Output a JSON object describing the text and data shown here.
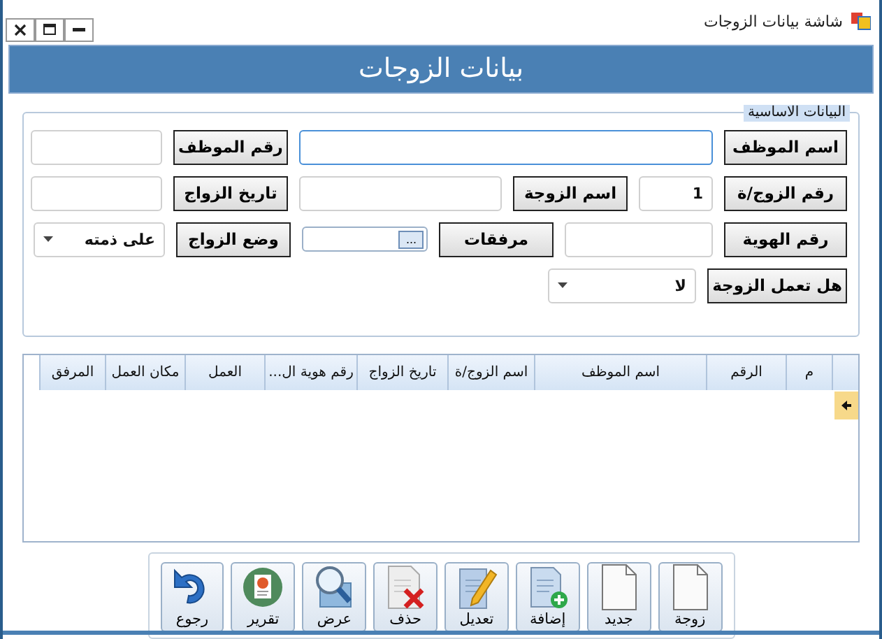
{
  "window": {
    "title": "شاشة بيانات الزوجات"
  },
  "header": {
    "title": "بيانات الزوجات"
  },
  "basic_data": {
    "legend": "البيانات الاساسية",
    "fields": [
      {
        "label": "اسم الموظف",
        "input": {
          "kind": "text",
          "focused": true
        }
      },
      {
        "label": "رقم الموظف",
        "input": {
          "kind": "text",
          "focused": false
        }
      },
      {
        "label": "رقم الزوج/ة",
        "input": {
          "kind": "text",
          "value": "1",
          "focused": false
        }
      },
      {
        "label": "اسم الزوجة",
        "input": {
          "kind": "text",
          "focused": false
        }
      },
      {
        "label": "تاريخ الزواج",
        "input": {
          "kind": "text",
          "focused": false
        }
      },
      {
        "label": "رقم الهوية",
        "input": {
          "kind": "text",
          "focused": false
        }
      },
      {
        "label": "مرفقات",
        "input": {
          "kind": "file",
          "button": "..."
        }
      },
      {
        "label": "وضع الزواج",
        "input": {
          "kind": "combo",
          "value": "على ذمته"
        }
      },
      {
        "label": "هل تعمل الزوجة",
        "input": {
          "kind": "combo",
          "value": "لا"
        }
      }
    ]
  },
  "table": {
    "columns": [
      "م",
      "الرقم",
      "اسم الموظف",
      "اسم الزوج/ة",
      "تاريخ الزواج",
      "رقم هوية ال...",
      "العمل",
      "مكان العمل",
      "المرفق"
    ]
  },
  "toolbar": {
    "buttons": [
      "زوجة",
      "جديد",
      "إضافة",
      "تعديل",
      "حذف",
      "عرض",
      "تقرير",
      "رجوع"
    ]
  }
}
